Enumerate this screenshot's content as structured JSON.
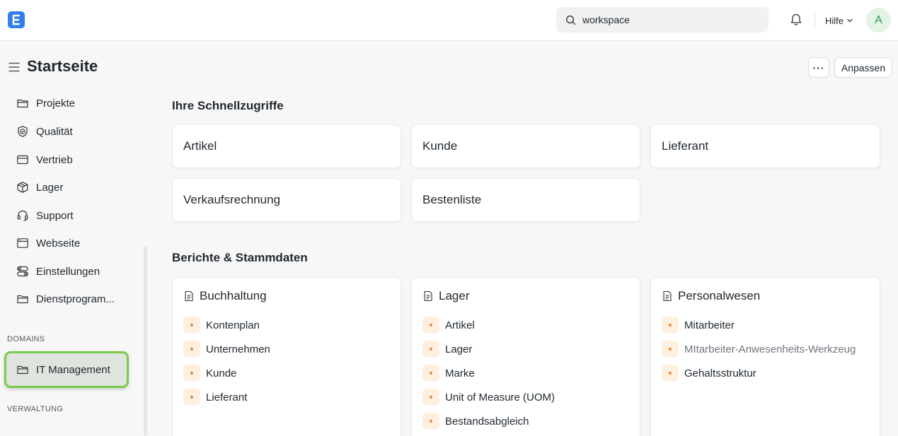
{
  "navbar": {
    "logo_letter": "E",
    "search": {
      "value": "workspace",
      "placeholder": ""
    },
    "help_label": "Hilfe",
    "avatar_initial": "A"
  },
  "page": {
    "title": "Startseite",
    "more_label": "···",
    "customize_label": "Anpassen"
  },
  "sidebar": {
    "items": [
      {
        "label": "Projekte",
        "icon": "folder-icon"
      },
      {
        "label": "Qualität",
        "icon": "quality-badge-icon"
      },
      {
        "label": "Vertrieb",
        "icon": "card-icon"
      },
      {
        "label": "Lager",
        "icon": "box-icon"
      },
      {
        "label": "Support",
        "icon": "headset-icon"
      },
      {
        "label": "Webseite",
        "icon": "browser-icon"
      },
      {
        "label": "Einstellungen",
        "icon": "settings-toggle-icon"
      },
      {
        "label": "Dienstprogram...",
        "icon": "folder-icon"
      }
    ],
    "domains_heading": "DOMAINS",
    "domains_items": [
      {
        "label": "IT Management",
        "icon": "folder-icon"
      }
    ],
    "admin_heading": "VERWALTUNG"
  },
  "shortcuts": {
    "heading": "Ihre Schnellzugriffe",
    "items": [
      "Artikel",
      "Kunde",
      "Lieferant",
      "Verkaufsrechnung",
      "Bestenliste"
    ]
  },
  "reports": {
    "heading": "Berichte & Stammdaten",
    "cards": [
      {
        "title": "Buchhaltung",
        "links": [
          "Kontenplan",
          "Unternehmen",
          "Kunde",
          "Lieferant"
        ]
      },
      {
        "title": "Lager",
        "links": [
          "Artikel",
          "Lager",
          "Marke",
          "Unit of Measure (UOM)",
          "Bestandsabgleich"
        ]
      },
      {
        "title": "Personalwesen",
        "links": [
          "Mitarbeiter",
          "MItarbeiter-Anwesenheits-Werkzeug",
          "Gehaltsstruktur"
        ]
      }
    ]
  },
  "colors": {
    "accent": "#2f7fe5",
    "active_border": "#7acb4a",
    "dot": "#e8893a",
    "dot_bg": "#fdf0e1"
  }
}
